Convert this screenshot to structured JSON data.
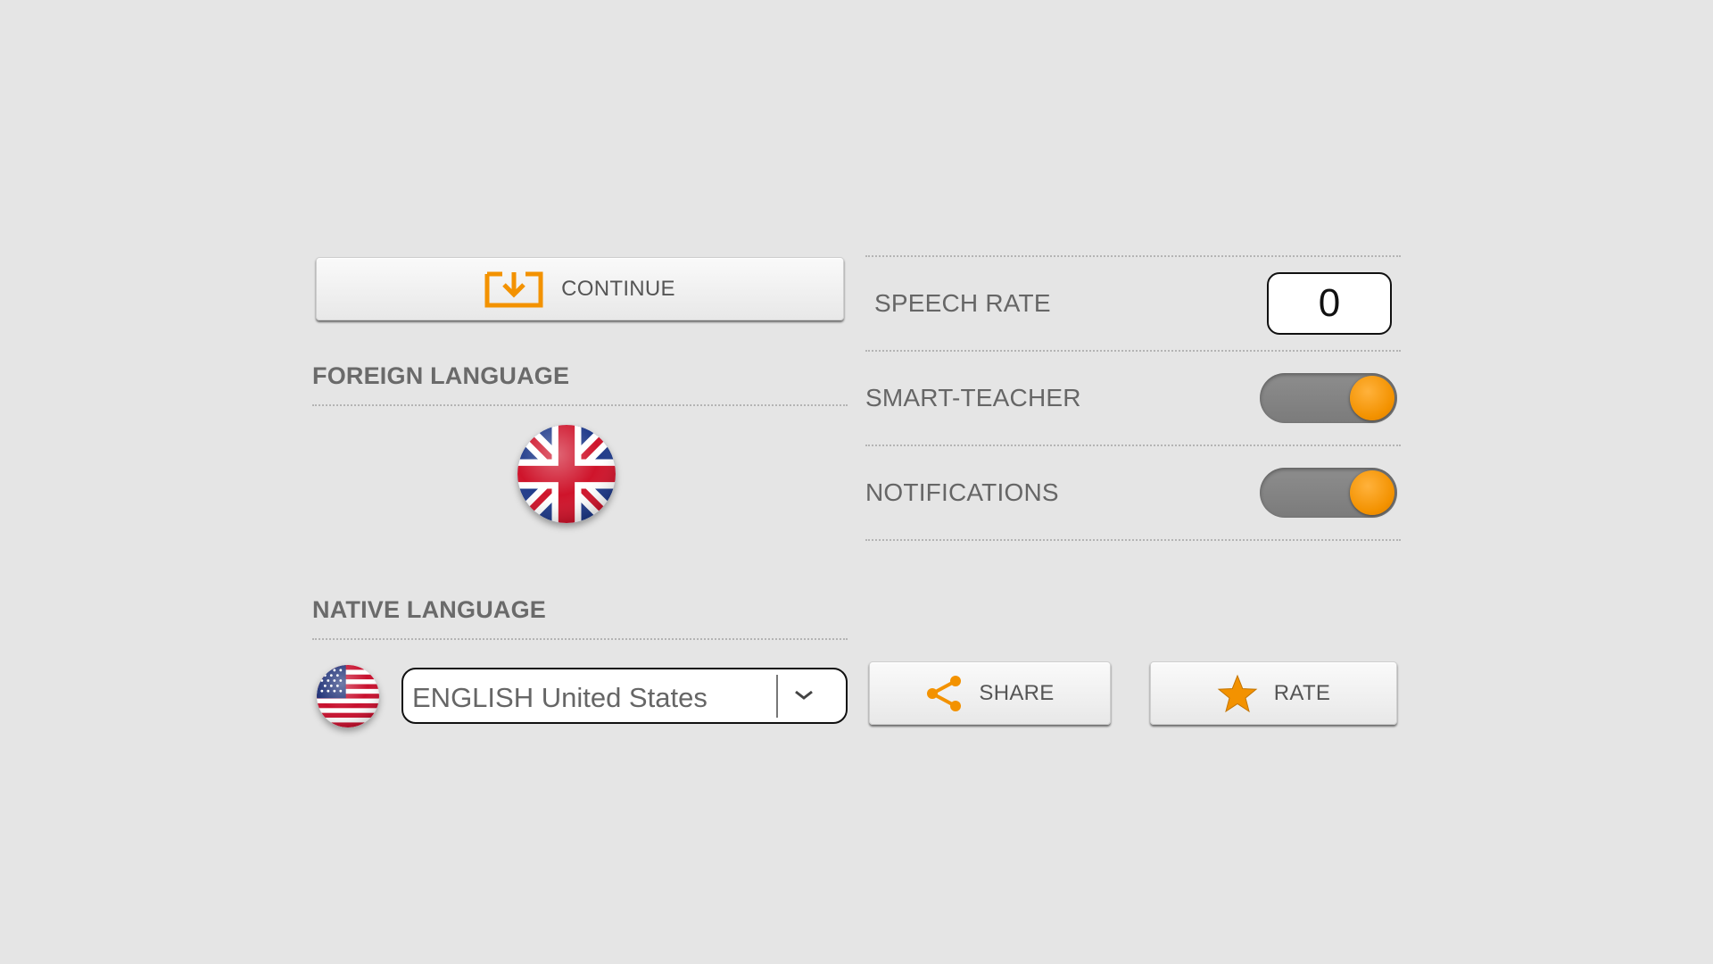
{
  "continue_button": {
    "label": "CONTINUE",
    "icon": "download-icon",
    "icon_color": "#f39200"
  },
  "foreign_language": {
    "heading": "FOREIGN LANGUAGE",
    "flag": "uk-flag-icon"
  },
  "native_language": {
    "heading": "NATIVE LANGUAGE",
    "flag": "us-flag-icon",
    "selected": "ENGLISH United States"
  },
  "settings": {
    "speech_rate": {
      "label": "SPEECH RATE",
      "value": "0"
    },
    "smart_teacher": {
      "label": "SMART-TEACHER",
      "on": true
    },
    "notifications": {
      "label": "NOTIFICATIONS",
      "on": true
    }
  },
  "share_button": {
    "label": "SHARE",
    "icon": "share-icon"
  },
  "rate_button": {
    "label": "RATE",
    "icon": "star-icon"
  },
  "colors": {
    "accent": "#f39200",
    "background": "#e5e5e5",
    "toggle_track": "#858585"
  }
}
